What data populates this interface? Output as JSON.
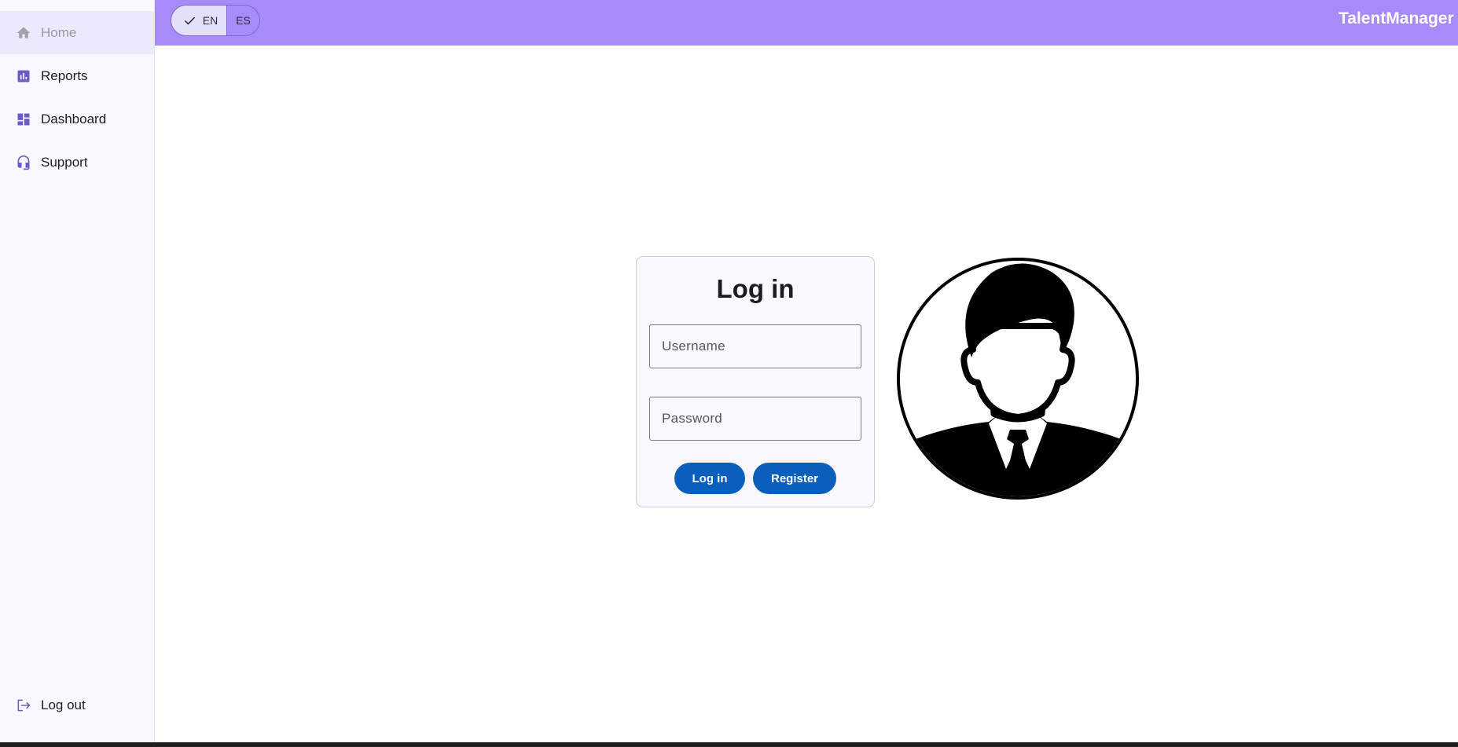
{
  "app": {
    "brand": "TalentManager"
  },
  "sidebar": {
    "items": [
      {
        "label": "Home",
        "icon": "home-icon",
        "active": true
      },
      {
        "label": "Reports",
        "icon": "bar-chart-icon",
        "active": false
      },
      {
        "label": "Dashboard",
        "icon": "dashboard-icon",
        "active": false
      },
      {
        "label": "Support",
        "icon": "headset-icon",
        "active": false
      }
    ],
    "logout_label": "Log out"
  },
  "language": {
    "options": [
      "EN",
      "ES"
    ],
    "selected": "EN"
  },
  "login": {
    "title": "Log in",
    "username_placeholder": "Username",
    "username_value": "",
    "password_placeholder": "Password",
    "password_value": "",
    "login_button": "Log in",
    "register_button": "Register"
  },
  "colors": {
    "topbar": "#a78bfa",
    "primary_button": "#0b5fbc",
    "sidebar_bg": "#f8f8fe",
    "sidebar_active": "#ebeafc",
    "icon_accent": "#6a5acd"
  }
}
